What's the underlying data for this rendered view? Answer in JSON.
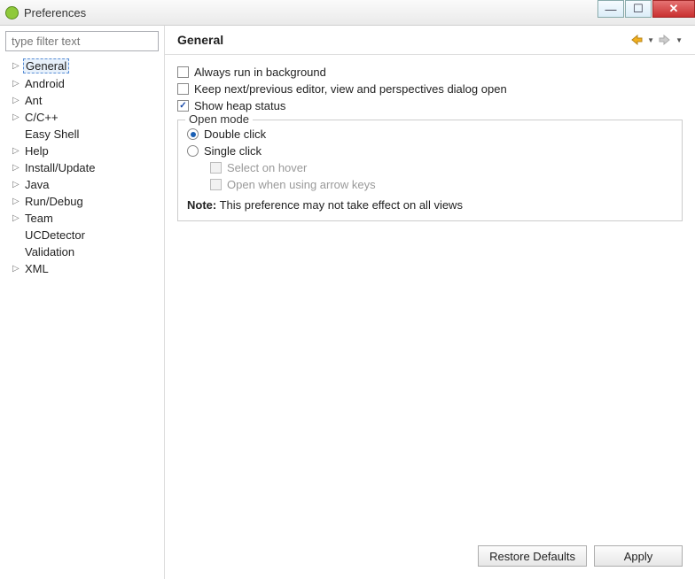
{
  "window": {
    "title": "Preferences"
  },
  "sidebar": {
    "filter_placeholder": "type filter text",
    "items": [
      {
        "label": "General",
        "expandable": true,
        "selected": true
      },
      {
        "label": "Android",
        "expandable": true
      },
      {
        "label": "Ant",
        "expandable": true
      },
      {
        "label": "C/C++",
        "expandable": true
      },
      {
        "label": "Easy Shell",
        "expandable": false
      },
      {
        "label": "Help",
        "expandable": true
      },
      {
        "label": "Install/Update",
        "expandable": true
      },
      {
        "label": "Java",
        "expandable": true
      },
      {
        "label": "Run/Debug",
        "expandable": true
      },
      {
        "label": "Team",
        "expandable": true
      },
      {
        "label": "UCDetector",
        "expandable": false
      },
      {
        "label": "Validation",
        "expandable": false
      },
      {
        "label": "XML",
        "expandable": true
      }
    ]
  },
  "page": {
    "heading": "General",
    "opt_background": "Always run in background",
    "opt_keep_editor": "Keep next/previous editor, view and perspectives dialog open",
    "opt_heap": "Show heap status",
    "open_mode": {
      "legend": "Open mode",
      "double": "Double click",
      "single": "Single click",
      "select_hover": "Select on hover",
      "open_arrow": "Open when using arrow keys",
      "note_label": "Note:",
      "note_text": "This preference may not take effect on all views"
    }
  },
  "footer": {
    "restore": "Restore Defaults",
    "apply": "Apply"
  }
}
